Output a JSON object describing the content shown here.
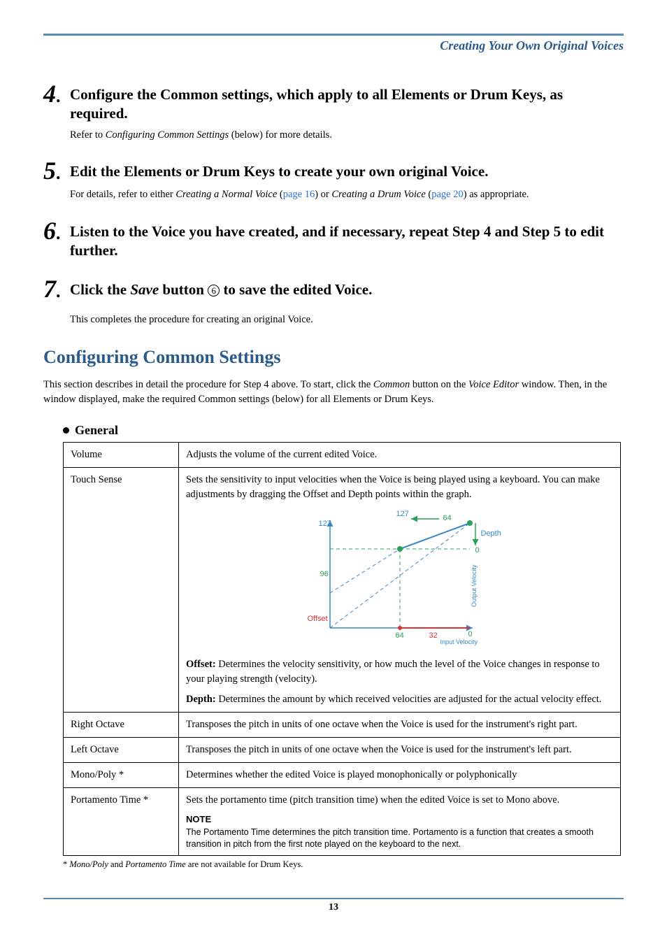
{
  "header": {
    "breadcrumb": "Creating Your Own Original Voices"
  },
  "steps": [
    {
      "num": "4",
      "title": "Configure the Common settings, which apply to all Elements or Drum Keys, as required.",
      "body_pre": "Refer to ",
      "body_ital": "Configuring Common Settings",
      "body_post": " (below) for more details."
    },
    {
      "num": "5",
      "title": "Edit the Elements or Drum Keys to create your own original Voice.",
      "body_pre": "For details, refer to either ",
      "body_ital1": "Creating a Normal Voice",
      "body_mid1": " (",
      "body_link1": "page 16",
      "body_mid2": ") or ",
      "body_ital2": "Creating a Drum Voice",
      "body_mid3": " (",
      "body_link2": "page 20",
      "body_post": ") as appropriate."
    },
    {
      "num": "6",
      "title": "Listen to the Voice you have created, and if necessary, repeat Step 4 and Step 5 to edit further."
    },
    {
      "num": "7",
      "title_pre": "Click the ",
      "title_ital": "Save",
      "title_mid": " button ",
      "title_circ": "6",
      "title_post": " to save the edited Voice."
    }
  ],
  "after_steps": "This completes the procedure for creating an original Voice.",
  "section": {
    "title": "Configuring Common Settings",
    "body_pre": "This section describes in detail the procedure for Step 4 above. To start, click the ",
    "body_ital1": "Common",
    "body_mid": " button on the ",
    "body_ital2": "Voice Editor",
    "body_post": " window. Then, in the window displayed, make the required Common settings (below) for all Elements or Drum Keys."
  },
  "general": {
    "heading": "General",
    "rows": {
      "volume": {
        "label": "Volume",
        "text": "Adjusts the volume of the current edited Voice."
      },
      "touch": {
        "label": "Touch Sense",
        "intro_pre": "Sets the sensitivity to input velocities when the Voice is being played using a keyboard. You can make adjustments by dragging the ",
        "intro_ital1": "Offset",
        "intro_mid": " and ",
        "intro_ital2": "Depth",
        "intro_post": " points within the graph.",
        "offset_strong": "Offset:",
        "offset_text": " Determines the velocity sensitivity, or how much the level of the Voice changes in response to your playing strength (velocity).",
        "depth_strong": "Depth:",
        "depth_text": " Determines the amount by which received velocities are adjusted for the actual velocity effect."
      },
      "right": {
        "label": "Right Octave",
        "text": "Transposes the pitch in units of one octave when the Voice is used for the instrument's right part."
      },
      "left": {
        "label": "Left Octave",
        "text": "Transposes the pitch in units of one octave when the Voice is used for the instrument's left part."
      },
      "mono": {
        "label": "Mono/Poly *",
        "text": "Determines whether the edited Voice is played monophonically or polyphonically"
      },
      "port": {
        "label": "Portamento Time *",
        "text": "Sets the portamento time (pitch transition time) when the edited Voice is set to Mono above.",
        "note_title": "NOTE",
        "note_body": "The Portamento Time determines the pitch transition time. Portamento is a function that creates a smooth transition in pitch from the first note played on the keyboard to the next."
      }
    }
  },
  "footnote": {
    "pre": "* ",
    "ital1": "Mono/Poly",
    "mid": " and ",
    "ital2": "Portamento Time",
    "post": " are not available for Drum Keys."
  },
  "page_number": "13",
  "chart_data": {
    "type": "line",
    "xlabel": "Input Velocity",
    "ylabel": "Output Velocity",
    "xlim": [
      0,
      127
    ],
    "ylim": [
      0,
      127
    ],
    "axis_ticks": {
      "x_max": "127",
      "y_max": "127",
      "x_zero": "0",
      "y_zero": "0"
    },
    "labels": {
      "top_center": "127",
      "depth_value": "64",
      "depth_label": "Depth",
      "offset_y_tick": "96",
      "offset_label": "Offset",
      "offset_x_tick": "64",
      "mid_x_tick": "32"
    },
    "solid_line": {
      "x": [
        64,
        127
      ],
      "y": [
        96,
        127
      ]
    },
    "dashed_lines": [
      {
        "x": [
          0,
          127
        ],
        "y": [
          0,
          127
        ]
      },
      {
        "x": [
          0,
          64
        ],
        "y": [
          64,
          96
        ]
      }
    ],
    "offset_point": {
      "x": 64,
      "y": 96
    },
    "depth_point": {
      "x": 127,
      "y": 127
    },
    "depth_arrow": {
      "from_y": 127,
      "to_y": 96,
      "at_x": 130
    },
    "offset_x_range": {
      "from": 64,
      "to": 127,
      "at_y": -4
    }
  }
}
